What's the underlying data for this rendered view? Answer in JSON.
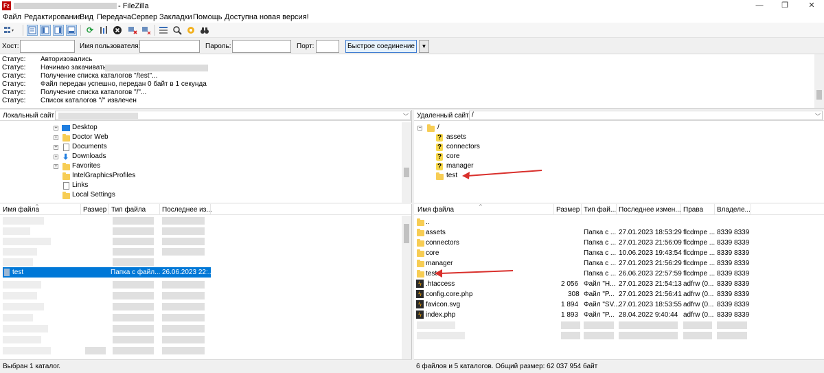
{
  "window": {
    "title": "- FileZilla",
    "logo": "Fz",
    "controls": [
      "—",
      "❐",
      "✕"
    ]
  },
  "menu": [
    "Файл",
    "Редактирование",
    "Вид",
    "Передача",
    "Сервер",
    "Закладки",
    "Помощь",
    "Доступна новая версия!"
  ],
  "quickconnect": {
    "host_label": "Хост:",
    "user_label": "Имя пользователя:",
    "pass_label": "Пароль:",
    "port_label": "Порт:",
    "connect_button": "Быстрое соединение",
    "dropdown_glyph": "▼"
  },
  "log": [
    {
      "key": "Статус:",
      "msg": "Авторизовались"
    },
    {
      "key": "Статус:",
      "msg": "Начинаю закачивать"
    },
    {
      "key": "Статус:",
      "msg": "Получение списка каталогов \"/test\"..."
    },
    {
      "key": "Статус:",
      "msg": "Файл передан успешно, передан 0 байт в 1 секунда"
    },
    {
      "key": "Статус:",
      "msg": "Получение списка каталогов \"/\"..."
    },
    {
      "key": "Статус:",
      "msg": "Список каталогов \"/\" извлечен"
    }
  ],
  "local": {
    "site_label": "Локальный сайт:",
    "tree": [
      {
        "name": "Desktop",
        "icon": "desktop-icon",
        "expand": "+"
      },
      {
        "name": "Doctor Web",
        "icon": "folder-icon",
        "expand": "+"
      },
      {
        "name": "Documents",
        "icon": "documents-icon",
        "expand": "+"
      },
      {
        "name": "Downloads",
        "icon": "downloads-icon",
        "expand": "+"
      },
      {
        "name": "Favorites",
        "icon": "favorites-icon",
        "expand": "+"
      },
      {
        "name": "IntelGraphicsProfiles",
        "icon": "folder-icon",
        "expand": ""
      },
      {
        "name": "Links",
        "icon": "links-icon",
        "expand": ""
      },
      {
        "name": "Local Settings",
        "icon": "folder-icon",
        "expand": ""
      }
    ],
    "columns": [
      "Имя файла",
      "Размер",
      "Тип файла",
      "Последнее из..."
    ],
    "selected": {
      "name": "test",
      "type": "Папка с файл...",
      "date": "26.06.2023 22:..."
    },
    "status": "Выбран 1 каталог."
  },
  "remote": {
    "site_label": "Удаленный сайт:",
    "path": "/",
    "tree_root": "/",
    "tree": [
      "assets",
      "connectors",
      "core",
      "manager",
      "test"
    ],
    "columns": [
      "Имя файла",
      "Размер",
      "Тип фай...",
      "Последнее измен...",
      "Права",
      "Владеле..."
    ],
    "files": [
      {
        "name": "..",
        "size": "",
        "type": "",
        "date": "",
        "perms": "",
        "owner": "",
        "icon": "folder"
      },
      {
        "name": "assets",
        "size": "",
        "type": "Папка с ...",
        "date": "27.01.2023 18:53:29",
        "perms": "flcdmpe ...",
        "owner": "8339 8339",
        "icon": "folder"
      },
      {
        "name": "connectors",
        "size": "",
        "type": "Папка с ...",
        "date": "27.01.2023 21:56:09",
        "perms": "flcdmpe ...",
        "owner": "8339 8339",
        "icon": "folder"
      },
      {
        "name": "core",
        "size": "",
        "type": "Папка с ...",
        "date": "10.06.2023 19:43:54",
        "perms": "flcdmpe ...",
        "owner": "8339 8339",
        "icon": "folder"
      },
      {
        "name": "manager",
        "size": "",
        "type": "Папка с ...",
        "date": "27.01.2023 21:56:29",
        "perms": "flcdmpe ...",
        "owner": "8339 8339",
        "icon": "folder"
      },
      {
        "name": "test",
        "size": "",
        "type": "Папка с ...",
        "date": "26.06.2023 22:57:59",
        "perms": "flcdmpe ...",
        "owner": "8339 8339",
        "icon": "folder"
      },
      {
        "name": ".htaccess",
        "size": "2 056",
        "type": "Файл \"H...",
        "date": "27.01.2023 21:54:13",
        "perms": "adfrw (0...",
        "owner": "8339 8339",
        "icon": "file"
      },
      {
        "name": "config.core.php",
        "size": "308",
        "type": "Файл \"P...",
        "date": "27.01.2023 21:56:41",
        "perms": "adfrw (0...",
        "owner": "8339 8339",
        "icon": "file"
      },
      {
        "name": "favicon.svg",
        "size": "1 894",
        "type": "Файл \"SV...",
        "date": "27.01.2023 18:53:55",
        "perms": "adfrw (0...",
        "owner": "8339 8339",
        "icon": "file"
      },
      {
        "name": "index.php",
        "size": "1 893",
        "type": "Файл \"P...",
        "date": "28.04.2022 9:40:44",
        "perms": "adfrw (0...",
        "owner": "8339 8339",
        "icon": "file"
      }
    ],
    "status": "6 файлов и 5 каталогов. Общий размер: 62 037 954 байт"
  },
  "colors": {
    "selection": "#0078d7",
    "folder": "#f7cd54",
    "arrow": "#d9302c",
    "accent_button": "#3d7bd1"
  }
}
